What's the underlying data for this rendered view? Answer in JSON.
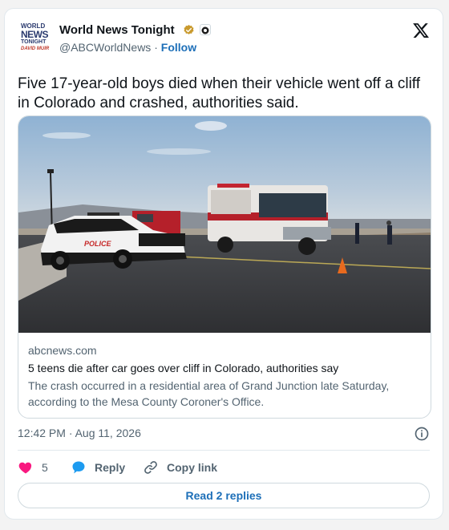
{
  "account": {
    "avatar_lines": [
      "WORLD",
      "NEWS",
      "TONIGHT",
      "DAVID MUIR"
    ],
    "display_name": "World News Tonight",
    "handle": "@ABCWorldNews",
    "separator": " · ",
    "follow_label": "Follow",
    "verified_color": "#c99a2e"
  },
  "tweet": {
    "text": "Five 17-year-old boys died when their vehicle went off a cliff in Colorado and crashed, authorities said.",
    "timestamp": "12:42 PM · Aug 11, 2026"
  },
  "link_card": {
    "domain": "abcnews.com",
    "title": "5 teens die after car goes over cliff in Colorado, authorities say",
    "description": "The crash occurred in a residential area of Grand Junction late Saturday, according to the Mesa County Coroner's Office.",
    "image_vehicle_text": "POLICE"
  },
  "actions": {
    "like_count": "5",
    "reply_label": "Reply",
    "copy_link_label": "Copy link"
  },
  "footer": {
    "read_replies_label": "Read 2 replies"
  },
  "colors": {
    "accent": "#1d6fb8",
    "heart": "#f91880",
    "reply_bubble": "#1d9bf0",
    "muted": "#536471"
  },
  "icons": {
    "logo": "x-logo-icon",
    "verified": "verified-badge-icon",
    "affiliate": "affiliate-badge-icon",
    "info": "info-icon",
    "heart": "heart-icon",
    "reply": "reply-bubble-icon",
    "copy_link": "link-icon"
  }
}
